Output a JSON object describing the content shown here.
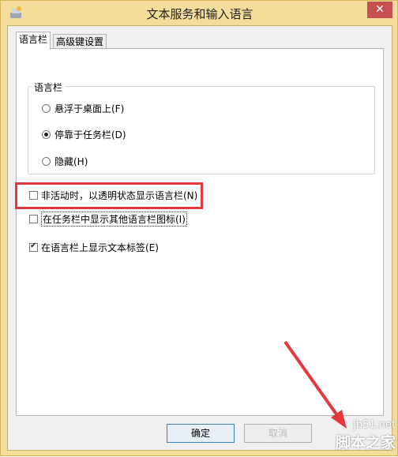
{
  "window": {
    "title": "文本服务和输入语言",
    "close_glyph": "✕"
  },
  "tabs": [
    {
      "label": "语言栏",
      "active": true
    },
    {
      "label": "高级键设置",
      "active": false
    }
  ],
  "language_bar_group": {
    "label": "语言栏",
    "options": [
      {
        "label": "悬浮于桌面上(F)",
        "checked": false
      },
      {
        "label": "停靠于任务栏(D)",
        "checked": true
      },
      {
        "label": "隐藏(H)",
        "checked": false
      }
    ]
  },
  "checkboxes": [
    {
      "label": "非活动时，以透明状态显示语言栏(N)",
      "checked": false
    },
    {
      "label": "在任务栏中显示其他语言栏图标(I)",
      "checked": false
    },
    {
      "label": "在语言栏上显示文本标签(E)",
      "checked": true
    }
  ],
  "buttons": {
    "ok": "确定",
    "cancel": "取消"
  },
  "watermark": {
    "site": "jb51.net",
    "name": "脚本之家"
  },
  "colors": {
    "highlight": "#e3383d",
    "arrow": "#e3383d",
    "title_bar": "#f4dc9b"
  }
}
